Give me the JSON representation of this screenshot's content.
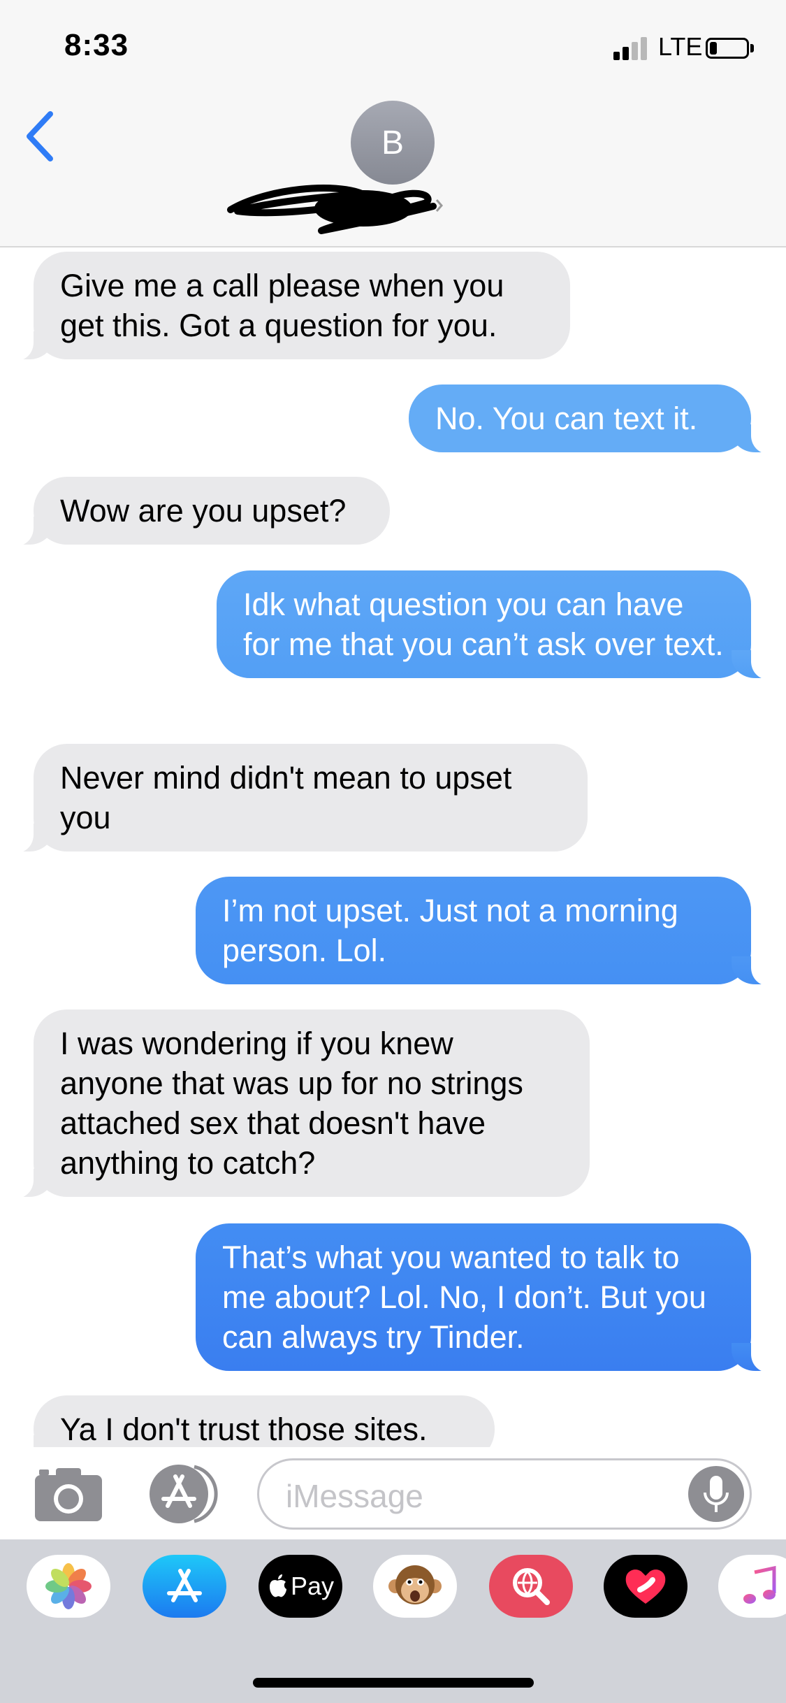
{
  "status": {
    "time": "8:33",
    "network": "LTE",
    "battery_level": 0.2
  },
  "header": {
    "avatar_initial": "B"
  },
  "messages": [
    {
      "from": "them",
      "text": "Give me a call please when you get this. Got a question for you."
    },
    {
      "from": "me",
      "text": "No. You can text it."
    },
    {
      "from": "them",
      "text": "Wow are you upset?"
    },
    {
      "from": "me",
      "text": "Idk what question you can have for me that you can’t ask over text."
    },
    {
      "from": "them",
      "text": "Never mind didn't mean to upset you"
    },
    {
      "from": "me",
      "text": "I’m not upset. Just not a morning person. Lol."
    },
    {
      "from": "them",
      "text": "I was wondering if you knew anyone that was up for no strings attached sex that doesn't have anything to catch?"
    },
    {
      "from": "me",
      "text": "That’s what you wanted to talk to me about? Lol. No, I don’t. But you can always try Tinder."
    },
    {
      "from": "them",
      "text": "Ya I don't trust those sites."
    }
  ],
  "input": {
    "placeholder": "iMessage"
  },
  "apps": {
    "items": [
      "photos-icon",
      "app-store-icon",
      "apple-pay-icon",
      "animoji-icon",
      "search-images-icon",
      "digital-touch-icon",
      "music-icon"
    ],
    "apple_pay_label": "Pay"
  },
  "colors": {
    "received_bubble": "#e9e9eb",
    "sent_bubble_top": "#64aaf5",
    "sent_bubble_bottom": "#3a7ef0",
    "accent": "#2f7cf6"
  }
}
